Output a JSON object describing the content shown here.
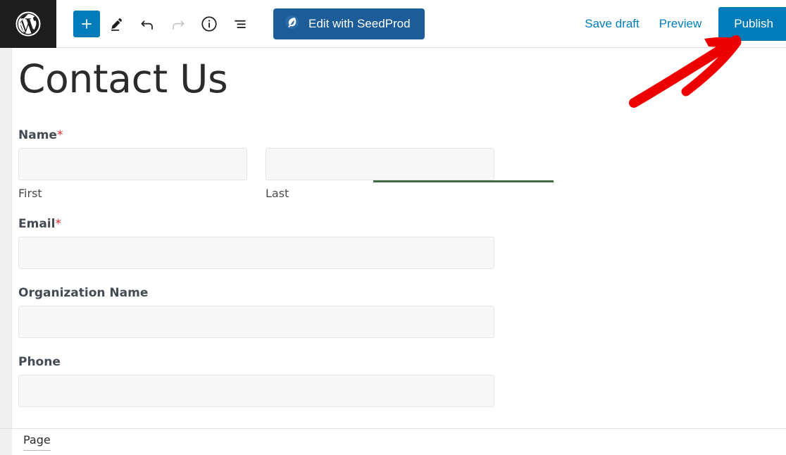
{
  "header": {
    "logo_icon": "wordpress-logo-icon",
    "tools": [
      {
        "name": "add-block-button",
        "icon": "plus-icon",
        "label": "Add block",
        "state": "primary"
      },
      {
        "name": "tools-pencil-button",
        "icon": "pencil-icon",
        "label": "Tools",
        "state": "normal"
      },
      {
        "name": "undo-button",
        "icon": "undo-arrow-icon",
        "label": "Undo",
        "state": "normal"
      },
      {
        "name": "redo-button",
        "icon": "redo-arrow-icon",
        "label": "Redo",
        "state": "disabled"
      },
      {
        "name": "details-button",
        "icon": "info-circle-icon",
        "label": "Details",
        "state": "normal"
      },
      {
        "name": "list-view-button",
        "icon": "list-view-icon",
        "label": "List View",
        "state": "normal"
      }
    ],
    "seedprod": {
      "label": "Edit with SeedProd",
      "icon": "seedprod-leaf-icon",
      "bg_color": "#1c5d99",
      "text_color": "#ffffff"
    },
    "save_draft_label": "Save draft",
    "preview_label": "Preview",
    "publish_label": "Publish",
    "link_color": "#007cba",
    "publish_bg": "#007cba"
  },
  "page": {
    "title": "Contact Us"
  },
  "form": {
    "fields": [
      {
        "label": "Name",
        "required": true,
        "type": "name-split",
        "subfields": [
          {
            "sub_label": "First",
            "value": ""
          },
          {
            "sub_label": "Last",
            "value": ""
          }
        ]
      },
      {
        "label": "Email",
        "required": true,
        "type": "text",
        "value": ""
      },
      {
        "label": "Organization Name",
        "required": false,
        "type": "text",
        "value": ""
      },
      {
        "label": "Phone",
        "required": false,
        "type": "text",
        "value": ""
      }
    ],
    "required_marker": "*"
  },
  "footer": {
    "breadcrumb_label": "Page"
  },
  "annotation": {
    "arrow_color": "#ee0000",
    "description": "red-arrow-pointing-to-publish-button"
  },
  "artifact": {
    "green_line_color": "#426b45"
  }
}
